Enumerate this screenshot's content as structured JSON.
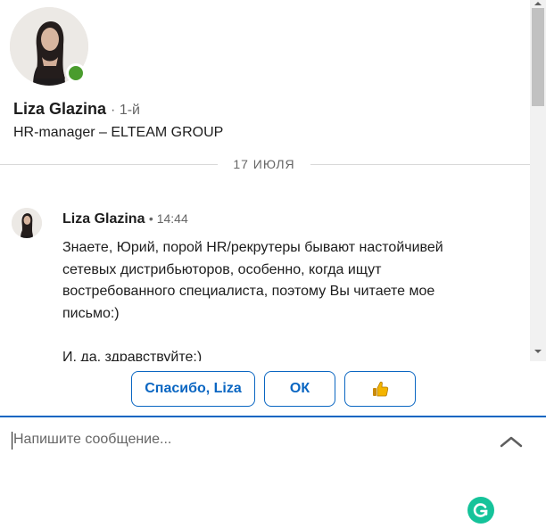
{
  "profile": {
    "name": "Liza Glazina",
    "degree": "· 1-й",
    "headline": "HR-manager – ELTEAM GROUP",
    "avatar_icon": "avatar-photo",
    "presence_color": "#4a9c2d",
    "presence_icon": "online-status-icon"
  },
  "divider": {
    "date": "17 ИЮЛЯ"
  },
  "message": {
    "sender": "Liza Glazina",
    "time": "• 14:44",
    "lines": [
      "Знаете, Юрий, порой HR/рекрутеры бывают настойчивей",
      "сетевых дистрибьюторов, особенно, когда ищут",
      "востребованного специалиста, поэтому Вы читаете мое",
      "письмо:)",
      "И, да, здравствуйте:)"
    ]
  },
  "quick_replies": {
    "reply1": "Спасибо, Liza",
    "reply2": "ОК",
    "reply3_icon": "thumbs-up-icon"
  },
  "composer": {
    "placeholder": "Напишите сообщение...",
    "expand_icon": "chevron-up-icon",
    "grammarly_icon": "grammarly-icon"
  },
  "colors": {
    "accent": "#0a66c2",
    "grammarly": "#15c39a",
    "presence": "#4a9c2d"
  }
}
